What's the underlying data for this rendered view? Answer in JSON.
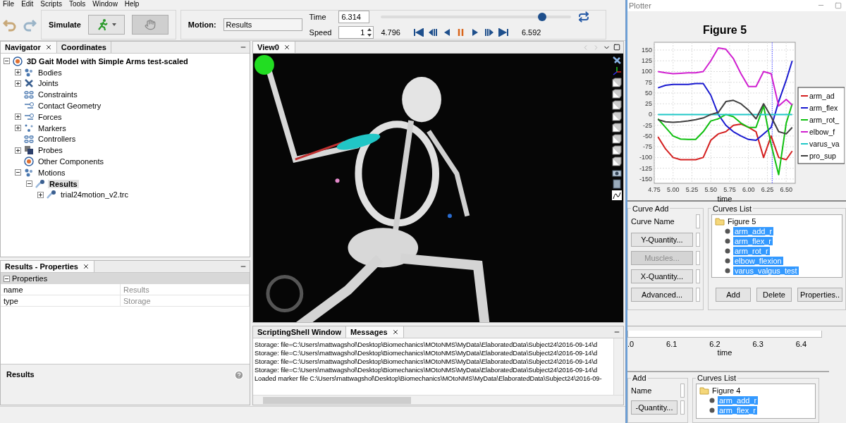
{
  "menu": [
    "File",
    "Edit",
    "Scripts",
    "Tools",
    "Window",
    "Help"
  ],
  "toolbar": {
    "simulate_label": "Simulate",
    "hand_button": {
      "disabled": true
    },
    "motion_label": "Motion:",
    "motion_value": "Results",
    "time_label": "Time",
    "time_value": "6.314",
    "speed_label": "Speed",
    "speed_value": "1",
    "start_time": "4.796",
    "end_time": "6.592",
    "time_slider": {
      "level": 0.845
    }
  },
  "navigator": {
    "tabs": [
      {
        "label": "Navigator",
        "selected": true
      },
      {
        "label": "Coordinates",
        "selected": false
      }
    ],
    "tree": {
      "label": "3D Gait Model with Simple Arms test-scaled",
      "kind": "model",
      "expanded": true,
      "selected": false,
      "children": [
        {
          "label": "Bodies",
          "kind": "bodies",
          "expanded": false,
          "selected": false
        },
        {
          "label": "Joints",
          "kind": "joints",
          "expanded": false,
          "selected": false
        },
        {
          "label": "Constraints",
          "kind": "link",
          "selected": false
        },
        {
          "label": "Contact Geometry",
          "kind": "forces",
          "selected": false
        },
        {
          "label": "Forces",
          "kind": "forces",
          "expanded": false,
          "selected": false
        },
        {
          "label": "Markers",
          "kind": "markers",
          "expanded": false,
          "selected": false
        },
        {
          "label": "Controllers",
          "kind": "link",
          "selected": false
        },
        {
          "label": "Probes",
          "kind": "probes",
          "expanded": false,
          "selected": false
        },
        {
          "label": "Other Components",
          "kind": "model",
          "selected": false
        },
        {
          "label": "Motions",
          "kind": "bodies",
          "expanded": true,
          "selected": false,
          "children": [
            {
              "label": "Results",
              "kind": "motion",
              "expanded": true,
              "selected": true,
              "children": [
                {
                  "label": "trial24motion_v2.trc",
                  "kind": "motion",
                  "expanded": false,
                  "selected": false
                }
              ]
            }
          ]
        }
      ]
    }
  },
  "properties": {
    "tab": "Results - Properties",
    "section": {
      "label": "Properties",
      "expanded": true
    },
    "rows": [
      {
        "name": "name",
        "value": "Results"
      },
      {
        "name": "type",
        "value": "Storage"
      }
    ],
    "description_title": "Results"
  },
  "view": {
    "tab": "View0"
  },
  "messages": {
    "tabs": [
      {
        "label": "ScriptingShell Window",
        "selected": false
      },
      {
        "label": "Messages",
        "selected": true
      }
    ],
    "lines": [
      "Storage: file=C:\\Users\\mattwagshol\\Desktop\\Biomechanics\\MOtoNMS\\MyData\\ElaboratedData\\Subject24\\2016-09-14\\d",
      "Storage: file=C:\\Users\\mattwagshol\\Desktop\\Biomechanics\\MOtoNMS\\MyData\\ElaboratedData\\Subject24\\2016-09-14\\d",
      "Storage: file=C:\\Users\\mattwagshol\\Desktop\\Biomechanics\\MOtoNMS\\MyData\\ElaboratedData\\Subject24\\2016-09-14\\d",
      "Storage: file=C:\\Users\\mattwagshol\\Desktop\\Biomechanics\\MOtoNMS\\MyData\\ElaboratedData\\Subject24\\2016-09-14\\d",
      "Loaded marker file C:\\Users\\mattwagshol\\Desktop\\Biomechanics\\MOtoNMS\\MyData\\ElaboratedData\\Subject24\\2016-09-"
    ]
  },
  "plotter": {
    "title": "Plotter",
    "chart_data": {
      "type": "line",
      "title": "Figure 5",
      "xlabel": "time",
      "x": [
        4.8,
        4.9,
        5.0,
        5.1,
        5.2,
        5.3,
        5.4,
        5.5,
        5.6,
        5.7,
        5.8,
        5.9,
        6.0,
        6.1,
        6.2,
        6.3,
        6.4,
        6.5,
        6.58
      ],
      "series": [
        {
          "name": "arm_ad",
          "color": "#d42020",
          "values": [
            -52,
            -80,
            -100,
            -105,
            -105,
            -105,
            -100,
            -60,
            -45,
            -40,
            -25,
            -22,
            -30,
            -40,
            -100,
            -50,
            -100,
            -105,
            -85
          ]
        },
        {
          "name": "arm_flex",
          "color": "#1a1ad0",
          "values": [
            62,
            68,
            70,
            70,
            70,
            72,
            72,
            45,
            0,
            -25,
            -40,
            -50,
            -58,
            -60,
            -45,
            -30,
            30,
            80,
            125
          ]
        },
        {
          "name": "arm_rot_",
          "color": "#10c010",
          "values": [
            -10,
            -30,
            -50,
            -57,
            -58,
            -58,
            -40,
            -15,
            -10,
            0,
            -5,
            -20,
            -30,
            -30,
            20,
            -70,
            -140,
            -20,
            25
          ]
        },
        {
          "name": "elbow_f",
          "color": "#d020d0",
          "values": [
            100,
            97,
            95,
            96,
            97,
            97,
            100,
            125,
            155,
            152,
            130,
            95,
            65,
            65,
            100,
            95,
            20,
            35,
            22
          ]
        },
        {
          "name": "varus_va",
          "color": "#20c8c8",
          "values": [
            0,
            0,
            0,
            0,
            0,
            0,
            0,
            0,
            0,
            0,
            0,
            0,
            0,
            0,
            0,
            0,
            0,
            0,
            0
          ]
        },
        {
          "name": "pro_sup",
          "color": "#404040",
          "values": [
            -12,
            -17,
            -18,
            -17,
            -15,
            -12,
            -8,
            0,
            5,
            30,
            33,
            25,
            10,
            -10,
            25,
            -5,
            -40,
            -45,
            -30
          ]
        }
      ],
      "xlim": [
        4.75,
        6.62
      ],
      "ylim": [
        -160,
        168
      ],
      "xticks": [
        {
          "value": 4.75,
          "label": "4.75"
        },
        {
          "value": 5,
          "label": "5.00"
        },
        {
          "value": 5.25,
          "label": "5.25"
        },
        {
          "value": 5.5,
          "label": "5.50"
        },
        {
          "value": 5.75,
          "label": "5.75"
        },
        {
          "value": 6,
          "label": "6.00"
        },
        {
          "value": 6.25,
          "label": "6.25"
        },
        {
          "value": 6.5,
          "label": "6.50"
        }
      ],
      "yticks": [
        -150,
        -125,
        -100,
        -75,
        -50,
        -25,
        0,
        25,
        50,
        75,
        100,
        125,
        150
      ],
      "grid": true,
      "legend": true,
      "ref_lines": [
        {
          "axis": "x",
          "value": 6.314
        }
      ]
    },
    "curve_add": {
      "title": "Curve Add",
      "name_label": "Curve Name",
      "buttons": [
        {
          "label": "Y-Quantity...",
          "disabled": false
        },
        {
          "label": "Muscles...",
          "disabled": true
        },
        {
          "label": "X-Quantity...",
          "disabled": false
        },
        {
          "label": "Advanced...",
          "disabled": false
        }
      ]
    },
    "curves_list": {
      "title": "Curves List",
      "root": "Figure 5",
      "items": [
        {
          "label": "arm_add_r",
          "selected": true
        },
        {
          "label": "arm_flex_r",
          "selected": true
        },
        {
          "label": "arm_rot_r",
          "selected": true
        },
        {
          "label": "elbow_flexion",
          "selected": true
        },
        {
          "label": "varus_valgus_test",
          "selected": true
        }
      ],
      "buttons": [
        "Add",
        "Delete",
        "Properties.."
      ]
    }
  },
  "back_plot": {
    "xtick_labels": [
      ".0",
      "6.1",
      "6.2",
      "6.3",
      "6.4"
    ],
    "xlabel": "time"
  },
  "back_panel": {
    "curve_add_title": "Add",
    "name_label": "Name",
    "button": "-Quantity...",
    "curves_list_title": "Curves List",
    "root": "Figure 4",
    "items": [
      {
        "label": "arm_add_r",
        "selected": true
      },
      {
        "label": "arm_flex_r",
        "selected": true
      }
    ]
  }
}
